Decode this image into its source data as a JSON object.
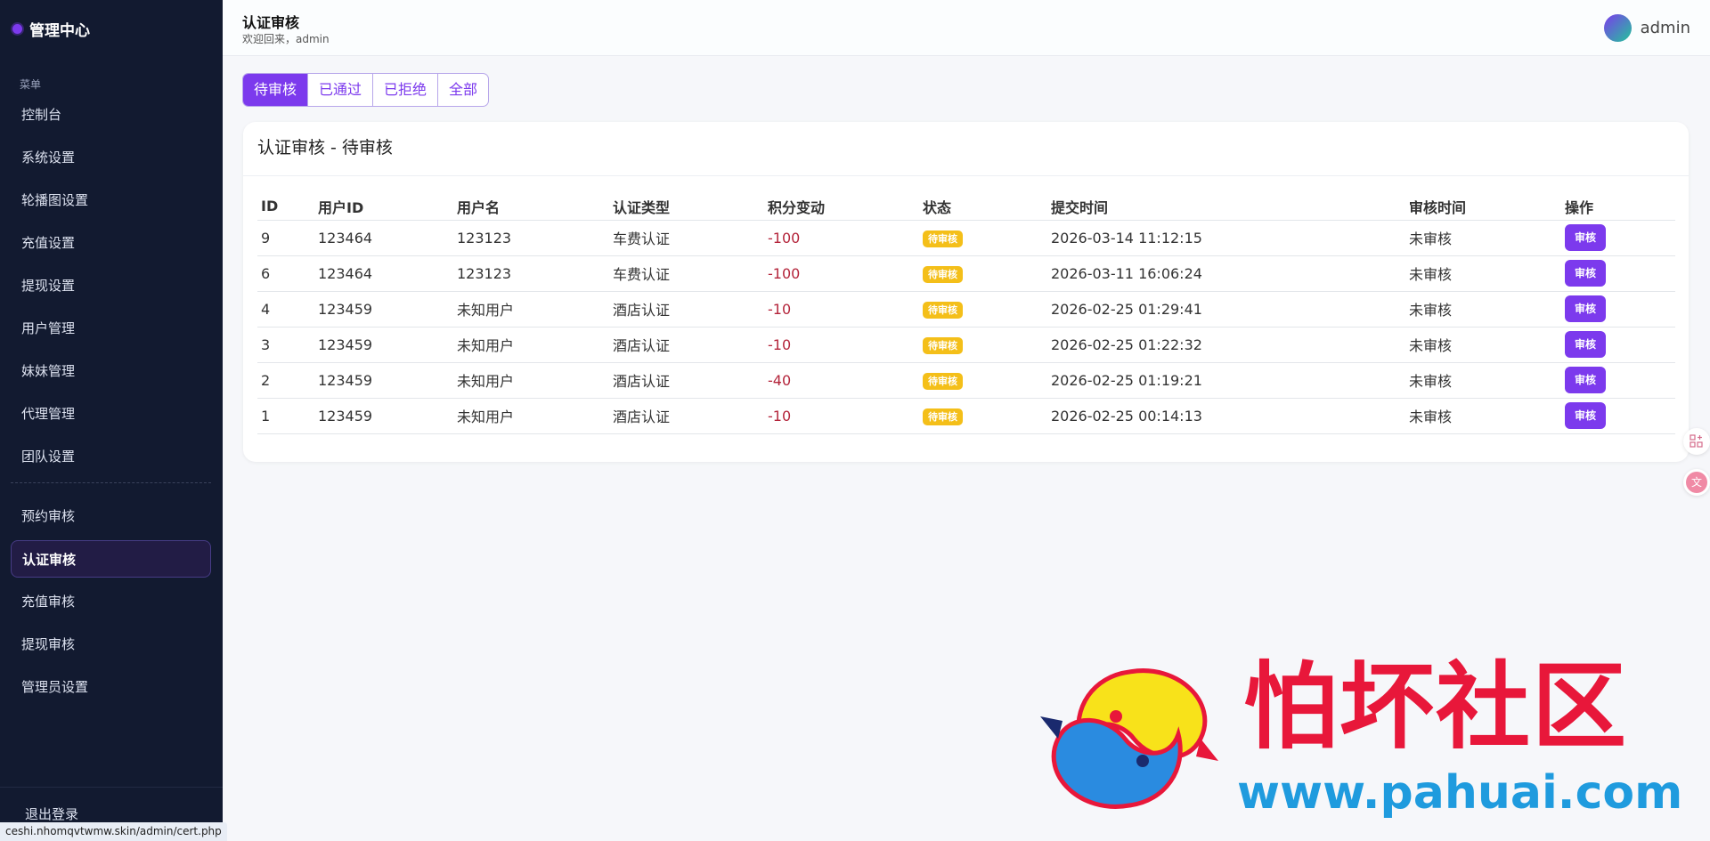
{
  "sidebar": {
    "brand": "管理中心",
    "menu_title": "菜单",
    "items_top": [
      "控制台",
      "系统设置",
      "轮播图设置",
      "充值设置",
      "提现设置",
      "用户管理",
      "妹妹管理",
      "代理管理",
      "团队设置"
    ],
    "items_bottom": [
      "预约审核",
      "认证审核",
      "充值审核",
      "提现审核",
      "管理员设置"
    ],
    "active": "认证审核",
    "logout": "退出登录"
  },
  "status_url": "ceshi.nhomqvtwmw.skin/admin/cert.php",
  "header": {
    "title": "认证审核",
    "subtitle": "欢迎回来，admin",
    "user": "admin"
  },
  "tabs": [
    {
      "label": "待审核",
      "active": true
    },
    {
      "label": "已通过",
      "active": false
    },
    {
      "label": "已拒绝",
      "active": false
    },
    {
      "label": "全部",
      "active": false
    }
  ],
  "card": {
    "title": "认证审核 - 待审核"
  },
  "table": {
    "columns": [
      "ID",
      "用户ID",
      "用户名",
      "认证类型",
      "积分变动",
      "状态",
      "提交时间",
      "审核时间",
      "操作"
    ],
    "rows": [
      {
        "id": "9",
        "user_id": "123464",
        "username": "123123",
        "type": "车费认证",
        "points": "-100",
        "status": "待审核",
        "submitted": "2026-03-14 11:12:15",
        "reviewed": "未审核",
        "action": "审核"
      },
      {
        "id": "6",
        "user_id": "123464",
        "username": "123123",
        "type": "车费认证",
        "points": "-100",
        "status": "待审核",
        "submitted": "2026-03-11 16:06:24",
        "reviewed": "未审核",
        "action": "审核"
      },
      {
        "id": "4",
        "user_id": "123459",
        "username": "未知用户",
        "type": "酒店认证",
        "points": "-10",
        "status": "待审核",
        "submitted": "2026-02-25 01:29:41",
        "reviewed": "未审核",
        "action": "审核"
      },
      {
        "id": "3",
        "user_id": "123459",
        "username": "未知用户",
        "type": "酒店认证",
        "points": "-10",
        "status": "待审核",
        "submitted": "2026-02-25 01:22:32",
        "reviewed": "未审核",
        "action": "审核"
      },
      {
        "id": "2",
        "user_id": "123459",
        "username": "未知用户",
        "type": "酒店认证",
        "points": "-40",
        "status": "待审核",
        "submitted": "2026-02-25 01:19:21",
        "reviewed": "未审核",
        "action": "审核"
      },
      {
        "id": "1",
        "user_id": "123459",
        "username": "未知用户",
        "type": "酒店认证",
        "points": "-10",
        "status": "待审核",
        "submitted": "2026-02-25 00:14:13",
        "reviewed": "未审核",
        "action": "审核"
      }
    ]
  },
  "watermark": {
    "title": "怕坏社区",
    "url": "www.pahuai.com"
  },
  "colors": {
    "accent": "#7c3aed",
    "sidebar_bg": "#121a30",
    "badge": "#f4bf19",
    "negative": "#b4253b"
  }
}
